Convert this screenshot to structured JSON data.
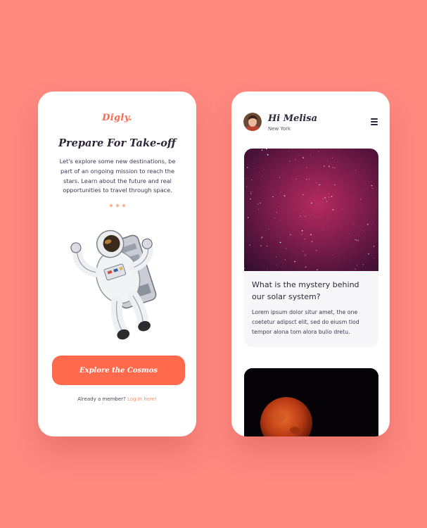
{
  "onboarding": {
    "logo": "Digly.",
    "title": "Prepare For Take-off",
    "description": "Let's explore some new destinations, be part of an ongoing mission to reach the stars. Learn about the future and real opportunities to travel through space.",
    "carousel_dots": 3,
    "cta_label": "Explore the Cosmos",
    "member_text": "Already a member?",
    "login_link": "Log in here!"
  },
  "feed": {
    "greeting": "Hi Melisa",
    "location": "New York",
    "cards": [
      {
        "title": "What is the mystery behind our solar system?",
        "body": "Lorem ipsum dolor situr amet, the one coetetur adipsct elit, sed do eiusm tlod tempor alona tom alora bulio dretu."
      }
    ]
  },
  "colors": {
    "background": "#ff8a80",
    "accent": "#ff6a4d",
    "link": "#ff8f6d",
    "text_dark": "#2c2838"
  },
  "icons": [
    "menu-icon",
    "avatar",
    "astronaut-image",
    "galaxy-image",
    "moon-image"
  ]
}
